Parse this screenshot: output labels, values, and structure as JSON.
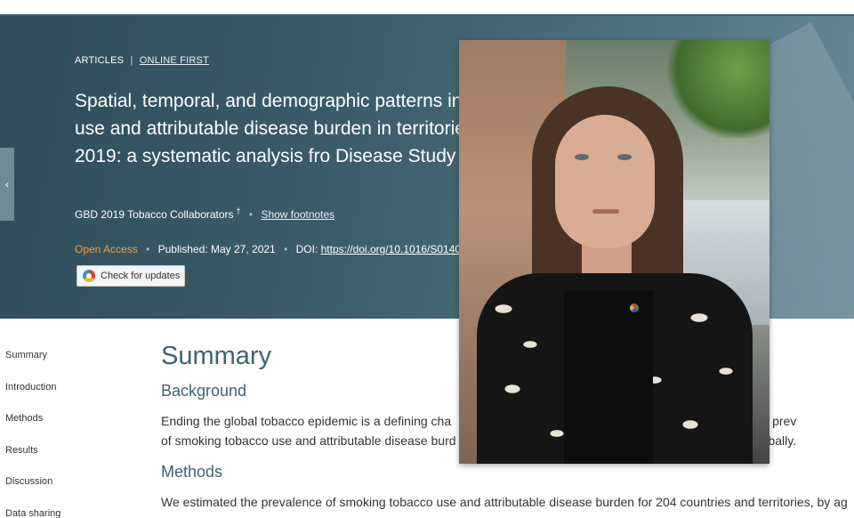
{
  "hero": {
    "kicker_section": "ARTICLES",
    "kicker_separator": "|",
    "kicker_status": "ONLINE FIRST",
    "title": "Spatial, temporal, and demographic patterns in tobacco use and attributable disease burden in territories, 1990–2019: a systematic analysis fro Disease Study 2019",
    "authors": "GBD 2019 Tobacco Collaborators",
    "author_marker": "†",
    "show_footnotes": "Show footnotes",
    "access": "Open Access",
    "published_label": "Published:",
    "published_date": "May 27, 2021",
    "doi_label": "DOI:",
    "doi_link": "https://doi.org/10.1016/S0140",
    "check_updates": "Check for updates",
    "side_tab_glyph": "‹"
  },
  "sidebar": {
    "items": [
      "Summary",
      "Introduction",
      "Methods",
      "Results",
      "Discussion",
      "Data sharing"
    ]
  },
  "content": {
    "heading": "Summary",
    "background_heading": "Background",
    "background_line1": "Ending the global tobacco epidemic is a defining cha                                                                           ates of the prev",
    "background_line2": "of smoking tobacco use and attributable disease burd                                                                          lly and globally.",
    "methods_heading": "Methods",
    "methods_line1": "We estimated the prevalence of smoking tobacco use and attributable disease burden for 204 countries and territories, by ag"
  },
  "colors": {
    "hero_bg": "#3b5c69",
    "open_access": "#f29c38",
    "heading": "#3c6470"
  },
  "icons": {
    "crossmark": "crossmark-badge-icon"
  }
}
